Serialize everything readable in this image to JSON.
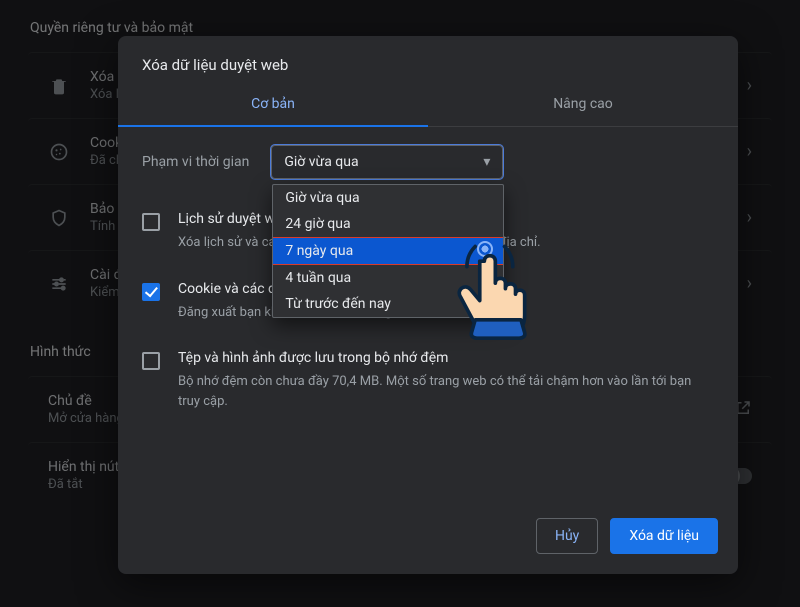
{
  "background": {
    "section1_title": "Quyền riêng tư và bảo mật",
    "items": [
      {
        "icon": "trash",
        "title": "Xóa dữ liệu duyệt web",
        "sub": "Xóa lịch sử, cookie, bộ nhớ đệm và các mục khác"
      },
      {
        "icon": "cookie",
        "title": "Cookie và dữ liệu trang web khác",
        "sub": "Đã chặn cookie của bên thứ ba ở chế độ Ẩn danh"
      },
      {
        "icon": "shield",
        "title": "Bảo mật",
        "sub": "Tính năng Duyệt web an toàn (bảo vệ bạn khỏi trang web nguy hiểm) và các chế độ cài đặt bảo mật khác"
      },
      {
        "icon": "sliders",
        "title": "Cài đặt trang web",
        "sub": "Kiểm soát thông tin trang web có thể sử dụng và hiển thị (vị trí, máy ảnh, cửa sổ bật lên và thông tin khác)"
      }
    ],
    "section2_title": "Hình thức",
    "items2": [
      {
        "title": "Chủ đề",
        "sub": "Mở cửa hàng Chrome trực tuyến",
        "trailing": "launch"
      },
      {
        "title": "Hiển thị nút trang chủ",
        "sub": "Đã tắt",
        "trailing": "toggle"
      }
    ]
  },
  "dialog": {
    "title": "Xóa dữ liệu duyệt web",
    "tabs": {
      "basic": "Cơ bản",
      "advanced": "Nâng cao"
    },
    "range_label": "Phạm vi thời gian",
    "range_value": "Giờ vừa qua",
    "dropdown_options": [
      "Giờ vừa qua",
      "24 giờ qua",
      "7 ngày qua",
      "4 tuần qua",
      "Từ trước đến nay"
    ],
    "dropdown_highlight_index": 2,
    "options": [
      {
        "checked": false,
        "title": "Lịch sử duyệt web",
        "sub": "Xóa lịch sử và các cụm từ tự động hoàn tất trong thanh địa chỉ."
      },
      {
        "checked": true,
        "title": "Cookie và các dữ liệu khác của trang web",
        "sub": "Đăng xuất bạn khỏi hầu hết các trang web."
      },
      {
        "checked": false,
        "title": "Tệp và hình ảnh được lưu trong bộ nhớ đệm",
        "sub": "Bộ nhớ đệm còn chưa đầy 70,4 MB. Một số trang web có thể tải chậm hơn vào lần tới bạn truy cập."
      }
    ],
    "buttons": {
      "cancel": "Hủy",
      "clear": "Xóa dữ liệu"
    }
  }
}
